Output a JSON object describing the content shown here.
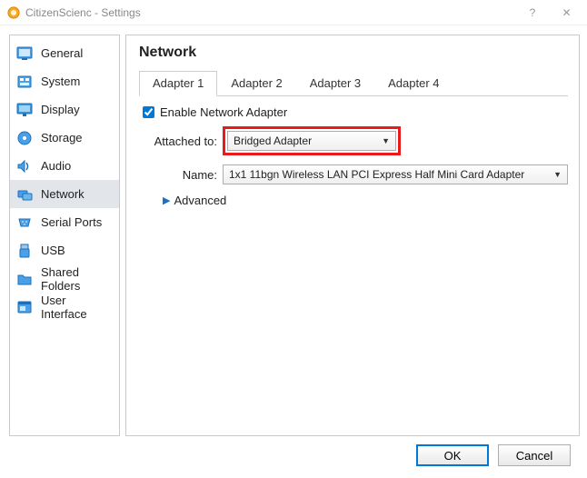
{
  "window": {
    "title": "CitizenScienc - Settings",
    "help_glyph": "?",
    "close_glyph": "✕"
  },
  "sidebar": {
    "items": [
      {
        "label": "General"
      },
      {
        "label": "System"
      },
      {
        "label": "Display"
      },
      {
        "label": "Storage"
      },
      {
        "label": "Audio"
      },
      {
        "label": "Network"
      },
      {
        "label": "Serial Ports"
      },
      {
        "label": "USB"
      },
      {
        "label": "Shared Folders"
      },
      {
        "label": "User Interface"
      }
    ],
    "selected_index": 5
  },
  "main": {
    "title": "Network",
    "tabs": [
      {
        "label": "Adapter 1"
      },
      {
        "label": "Adapter 2"
      },
      {
        "label": "Adapter 3"
      },
      {
        "label": "Adapter 4"
      }
    ],
    "active_tab": 0,
    "enable_label": "Enable Network Adapter",
    "enable_checked": true,
    "attached_label": "Attached to:",
    "attached_value": "Bridged Adapter",
    "name_label": "Name:",
    "name_value": "1x1 11bgn Wireless LAN PCI Express Half Mini Card Adapter",
    "advanced_label": "Advanced"
  },
  "footer": {
    "ok": "OK",
    "cancel": "Cancel"
  }
}
